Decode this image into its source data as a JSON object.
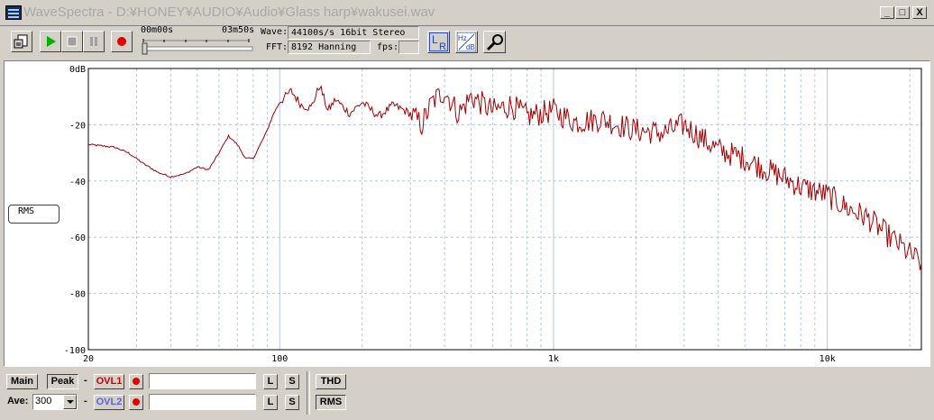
{
  "window": {
    "title": "WaveSpectra - D:¥HONEY¥AUDIO¥Audio¥Glass harp¥wakusei.wav",
    "min_label": "_",
    "max_label": "□",
    "close_label": "X"
  },
  "toolbar": {
    "time_start": "00m00s",
    "time_end": "03m50s",
    "wave_label": "Wave:",
    "wave_value": "44100s/s 16bit Stereo",
    "fft_label": "FFT:",
    "fft_value": "8192 Hanning",
    "fps_label": "fps:",
    "fps_value": "",
    "seek_position": 0.0,
    "lr_label_l": "L",
    "lr_label_r": "R",
    "hzdb_label_hz": "Hz",
    "hzdb_label_db": "dB"
  },
  "plot": {
    "mode_label": "RMS",
    "colors": {
      "trace": "#a00000",
      "grid": "#b8c4e0",
      "axis": "#000000"
    }
  },
  "chart_data": {
    "type": "line",
    "xscale": "log",
    "xlim": [
      20,
      22050
    ],
    "ylim": [
      -100,
      0
    ],
    "yticks": [
      0,
      -20,
      -40,
      -60,
      -80,
      -100
    ],
    "ytick_labels": [
      "0dB",
      "-20",
      "-40",
      "-60",
      "-80",
      "-100"
    ],
    "xticks": [
      20,
      100,
      1000,
      10000
    ],
    "xtick_labels": [
      "20",
      "100",
      "1k",
      "10k"
    ],
    "grid": true,
    "series": [
      {
        "color": "#a00000",
        "points": [
          [
            20,
            -27
          ],
          [
            25,
            -28
          ],
          [
            28,
            -30
          ],
          [
            32,
            -34
          ],
          [
            36,
            -37
          ],
          [
            40,
            -38.5
          ],
          [
            45,
            -37.5
          ],
          [
            50,
            -35
          ],
          [
            55,
            -36
          ],
          [
            60,
            -30
          ],
          [
            65,
            -24
          ],
          [
            70,
            -27
          ],
          [
            75,
            -32
          ],
          [
            80,
            -32
          ],
          [
            85,
            -27
          ],
          [
            90,
            -22
          ],
          [
            95,
            -16
          ],
          [
            100,
            -12
          ],
          [
            110,
            -8
          ],
          [
            120,
            -13
          ],
          [
            130,
            -14
          ],
          [
            140,
            -6
          ],
          [
            150,
            -15
          ],
          [
            160,
            -11
          ],
          [
            180,
            -16
          ],
          [
            200,
            -12
          ],
          [
            230,
            -17
          ],
          [
            260,
            -13
          ],
          [
            300,
            -16
          ],
          [
            330,
            -20
          ],
          [
            360,
            -12
          ],
          [
            400,
            -8
          ],
          [
            450,
            -16
          ],
          [
            500,
            -10
          ],
          [
            600,
            -15
          ],
          [
            700,
            -13
          ],
          [
            800,
            -17
          ],
          [
            1000,
            -15
          ],
          [
            1200,
            -19
          ],
          [
            1500,
            -18
          ],
          [
            2000,
            -22
          ],
          [
            2500,
            -23
          ],
          [
            3000,
            -20
          ],
          [
            3500,
            -25
          ],
          [
            4000,
            -29
          ],
          [
            5000,
            -32
          ],
          [
            6000,
            -36
          ],
          [
            7000,
            -39
          ],
          [
            8000,
            -42
          ],
          [
            10000,
            -45
          ],
          [
            12000,
            -50
          ],
          [
            14000,
            -53
          ],
          [
            16000,
            -58
          ],
          [
            18000,
            -62
          ],
          [
            20000,
            -66
          ],
          [
            22050,
            -69
          ]
        ]
      }
    ]
  },
  "bottom": {
    "main_label": "Main",
    "peak_label": "Peak",
    "dash1": "-",
    "ovl1_label": "OVL1",
    "l_label": "L",
    "s_label": "S",
    "ave_label": "Ave:",
    "ave_value": "300",
    "dash2": "-",
    "ovl2_label": "OVL2",
    "l2_label": "L",
    "s2_label": "S",
    "thd_label": "THD",
    "rms_label": "RMS",
    "ovl1_color": "#d00000",
    "ovl2_color": "#6060d0"
  }
}
